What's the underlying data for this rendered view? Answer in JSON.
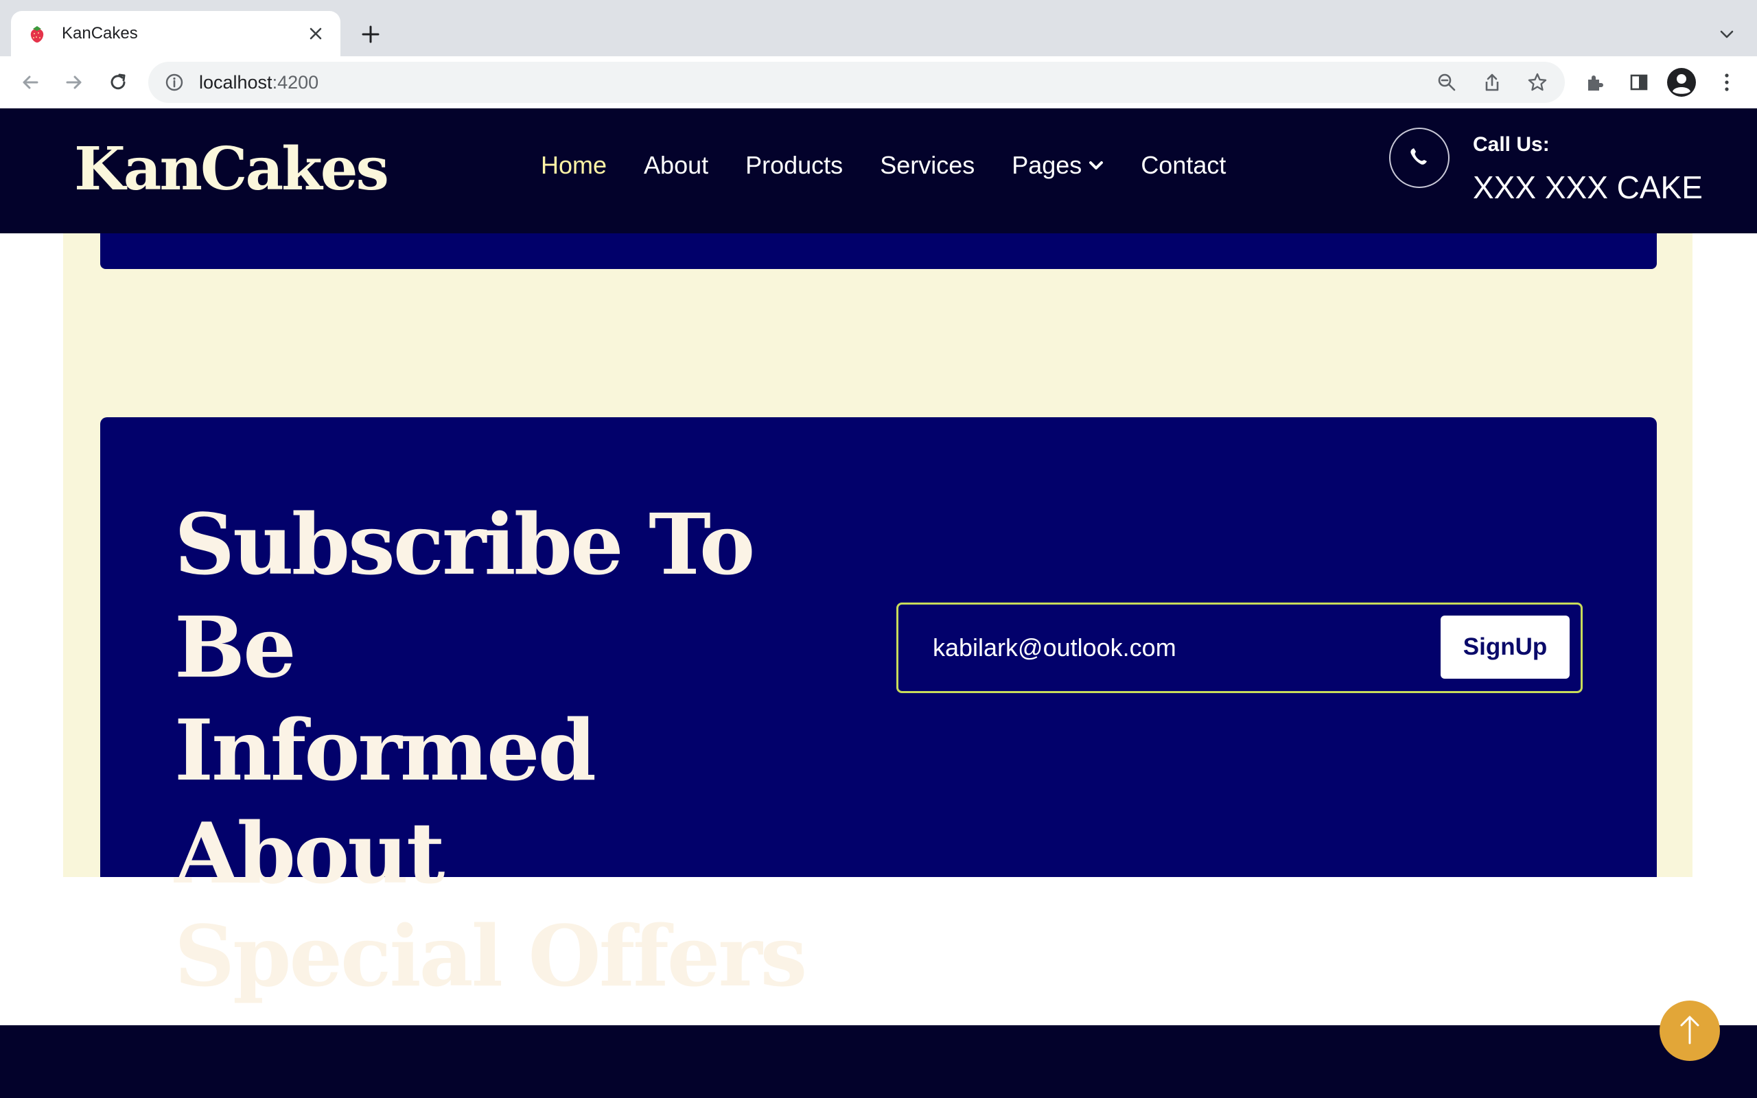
{
  "browser": {
    "tab": {
      "title": "KanCakes",
      "favicon": "strawberry-icon"
    },
    "address_bar": {
      "host": "localhost",
      "port": ":4200"
    },
    "icons": [
      "back-icon",
      "forward-icon",
      "reload-icon",
      "info-icon",
      "zoom-out-icon",
      "share-icon",
      "bookmark-star-icon",
      "extensions-icon",
      "side-panel-icon",
      "profile-icon",
      "menu-icon",
      "tab-search-icon",
      "new-tab-icon",
      "close-icon"
    ]
  },
  "header": {
    "logo": "KanCakes",
    "nav": [
      {
        "label": "Home",
        "active": true
      },
      {
        "label": "About"
      },
      {
        "label": "Products"
      },
      {
        "label": "Services"
      },
      {
        "label": "Pages",
        "has_dropdown": true
      },
      {
        "label": "Contact"
      }
    ],
    "call": {
      "label": "Call Us:",
      "number": "XXX XXX CAKE",
      "icon": "phone-icon"
    }
  },
  "subscribe": {
    "heading_lines": [
      "Subscribe To Be",
      "Informed About",
      "Special Offers"
    ],
    "email_value": "kabilark@outlook.com",
    "button_label": "SignUp"
  },
  "back_to_top": {
    "icon": "arrow-up-icon"
  },
  "colors": {
    "header_bg": "#03022b",
    "card_bg": "#02016b",
    "cream_bg": "#f9f6da",
    "nav_active": "#fdf3a6",
    "form_border": "#c8dc5a",
    "back_to_top": "#e2a638"
  }
}
